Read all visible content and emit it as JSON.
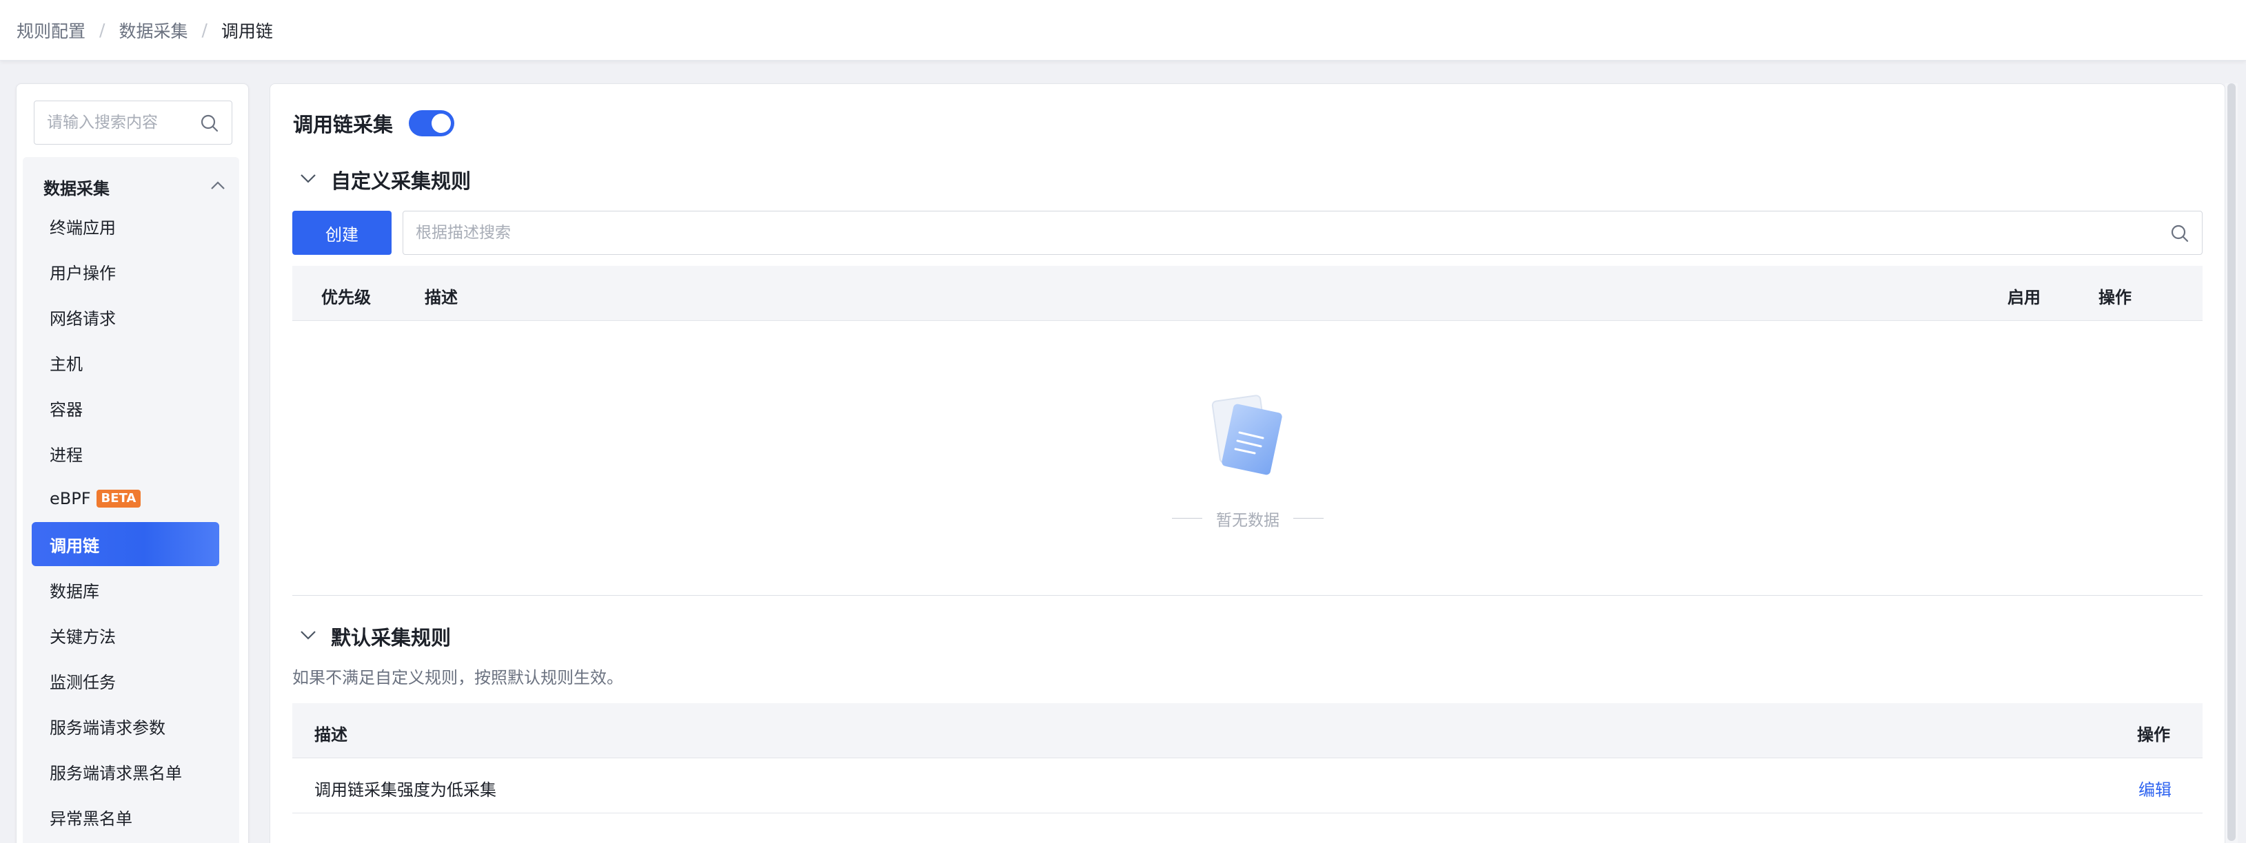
{
  "breadcrumb": [
    "规则配置",
    "数据采集",
    "调用链"
  ],
  "sidebar": {
    "search_placeholder": "请输入搜索内容",
    "group_title": "数据采集",
    "items": [
      {
        "label": "终端应用"
      },
      {
        "label": "用户操作"
      },
      {
        "label": "网络请求"
      },
      {
        "label": "主机"
      },
      {
        "label": "容器"
      },
      {
        "label": "进程"
      },
      {
        "label": "eBPF",
        "badge": "BETA"
      },
      {
        "label": "调用链",
        "active": true
      },
      {
        "label": "数据库"
      },
      {
        "label": "关键方法"
      },
      {
        "label": "监测任务"
      },
      {
        "label": "服务端请求参数"
      },
      {
        "label": "服务端请求黑名单"
      },
      {
        "label": "异常黑名单"
      }
    ]
  },
  "main": {
    "title": "调用链采集",
    "toggle_on": true,
    "custom_rules": {
      "title": "自定义采集规则",
      "create_label": "创建",
      "search_placeholder": "根据描述搜索",
      "columns": [
        "优先级",
        "描述",
        "启用",
        "操作"
      ],
      "empty_text": "暂无数据"
    },
    "default_rules": {
      "title": "默认采集规则",
      "description": "如果不满足自定义规则，按照默认规则生效。",
      "columns": [
        "描述",
        "操作"
      ],
      "rows": [
        {
          "desc": "调用链采集强度为低采集",
          "action": "编辑"
        }
      ]
    }
  },
  "colors": {
    "accent": "#2f64f0",
    "beta_badge": "#f07a2f",
    "header_bg": "#f4f5f8"
  }
}
